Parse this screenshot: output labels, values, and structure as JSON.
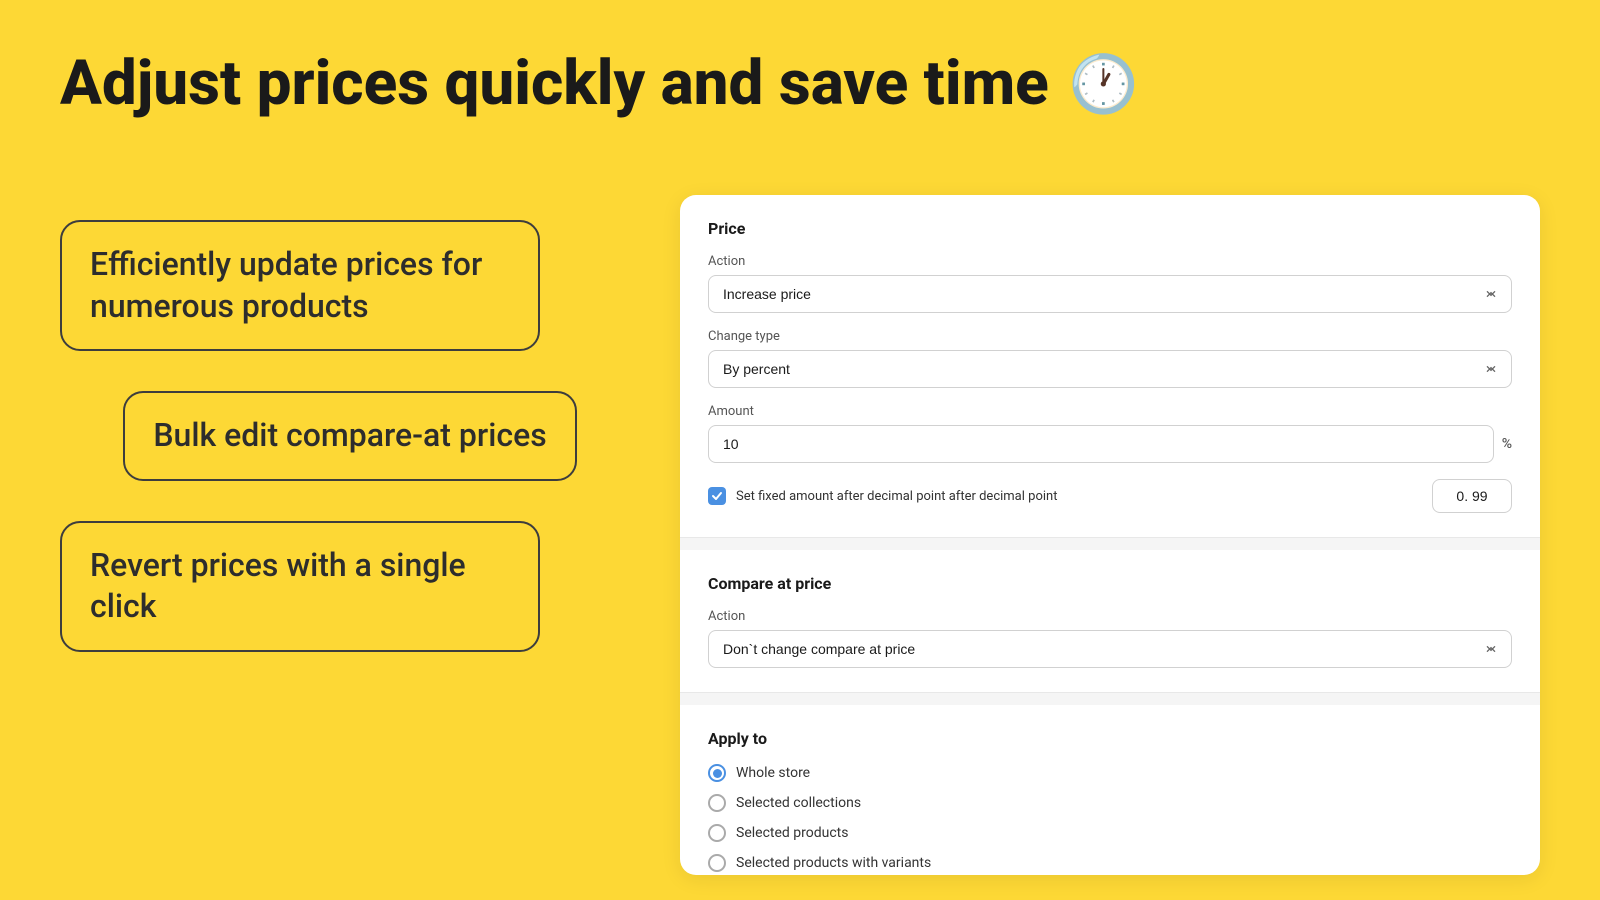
{
  "header": {
    "title": "Adjust prices quickly and save time",
    "clock_emoji": "🕐"
  },
  "features": [
    {
      "id": "feature-1",
      "text": "Efficiently update prices for numerous products"
    },
    {
      "id": "feature-2",
      "text": "Bulk edit compare-at prices"
    },
    {
      "id": "feature-3",
      "text": "Revert prices with a single click"
    }
  ],
  "form": {
    "price_section": {
      "title": "Price",
      "action_label": "Action",
      "action_value": "Increase price",
      "change_type_label": "Change type",
      "change_type_value": "By percent",
      "amount_label": "Amount",
      "amount_value": "10",
      "amount_unit": "%",
      "checkbox_label": "Set fixed amount after decimal point after decimal point",
      "decimal_value": "0. 99"
    },
    "compare_section": {
      "title": "Compare at price",
      "action_label": "Action",
      "action_value": "Don`t change compare at price"
    },
    "apply_section": {
      "title": "Apply to",
      "options": [
        {
          "label": "Whole store",
          "selected": true
        },
        {
          "label": "Selected collections",
          "selected": false
        },
        {
          "label": "Selected products",
          "selected": false
        },
        {
          "label": "Selected products with variants",
          "selected": false
        }
      ]
    }
  }
}
